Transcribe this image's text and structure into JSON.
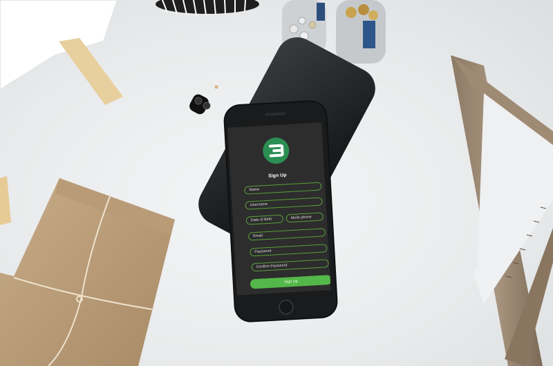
{
  "signup": {
    "title": "Sign Up",
    "fields": [
      {
        "label": "Name"
      },
      {
        "label": "Username"
      },
      {
        "label": "Date of Birth"
      },
      {
        "label": "Moile phone"
      },
      {
        "label": "Email"
      },
      {
        "label": "Password"
      },
      {
        "label": "Confirm Password"
      }
    ],
    "submit_label": "Sign Up",
    "logo_letter": "B"
  },
  "colors": {
    "accent_green": "#54b74a",
    "logo_green": "#2b8e53",
    "screen_bg": "#2d2d2d",
    "field_border": "#5aa03a"
  },
  "icons": [
    "brand-logo-icon"
  ]
}
